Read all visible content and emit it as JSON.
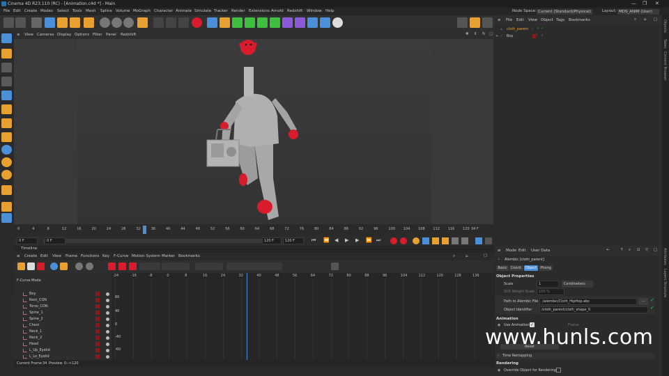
{
  "window": {
    "title": "Cinema 4D R23.110 (RC) - [Animation.c4d *] - Main",
    "controls": [
      "—",
      "❐",
      "✕"
    ]
  },
  "menubar": {
    "items": [
      "File",
      "Edit",
      "Create",
      "Modes",
      "Select",
      "Tools",
      "Mesh",
      "Spline",
      "Volume",
      "MoGraph",
      "Character",
      "Animate",
      "Simulate",
      "Tracker",
      "Render",
      "Extensions",
      "Arnold",
      "Redshift",
      "Window",
      "Help"
    ],
    "node_space_label": "Node Space:",
    "node_space_value": "Current (Standard/Physical)",
    "layout_label": "Layout:",
    "layout_value": "MDS_ANIM (User)"
  },
  "viewport": {
    "menu": [
      "View",
      "Cameras",
      "Display",
      "Options",
      "Filter",
      "Panel",
      "Redshift"
    ]
  },
  "ruler": {
    "ticks": [
      "0",
      "4",
      "8",
      "12",
      "16",
      "20",
      "24",
      "28",
      "32",
      "36",
      "40",
      "44",
      "48",
      "52",
      "56",
      "60",
      "64",
      "68",
      "72",
      "76",
      "80",
      "84",
      "88",
      "92",
      "96",
      "100",
      "104",
      "108",
      "112",
      "116",
      "120"
    ],
    "current_frame_label": "34 F",
    "current_frame": 34,
    "max_frame": 120
  },
  "playback": {
    "start_field": "0 F",
    "min_field": "0 F",
    "max_field": "120 F",
    "end_field": "120 F"
  },
  "timeline": {
    "title": "Timeline",
    "menu": [
      "Create",
      "Edit",
      "View",
      "Frame",
      "Functions",
      "Key",
      "F-Curve",
      "Motion System",
      "Marker",
      "Bookmarks"
    ],
    "mode_label": "F-Curve Mode",
    "tracks": [
      "Boy",
      "Root_CON",
      "Torso_CON",
      "Spine_1",
      "Spine_2",
      "Chest",
      "Neck_1",
      "Neck_2",
      "Head",
      "L_Up_Eyelid",
      "L_Lo_Eyelid"
    ],
    "graph_ticks": [
      "-24",
      "-16",
      "-8",
      "0",
      "8",
      "16",
      "24",
      "32",
      "40",
      "48",
      "56",
      "64",
      "72",
      "80",
      "88",
      "96",
      "104",
      "112",
      "120",
      "128",
      "136"
    ],
    "y_labels": [
      "60",
      "40",
      "0",
      "-40",
      "-60"
    ],
    "status_current_frame_label": "Current Frame",
    "status_current_frame": "34",
    "status_preview_label": "Preview",
    "status_preview": "0-->120"
  },
  "object_manager": {
    "menu": [
      "File",
      "Edit",
      "View",
      "Object",
      "Tags",
      "Bookmarks"
    ],
    "objects": [
      {
        "name": "cloth_parent",
        "selected": true
      },
      {
        "name": "Boy",
        "selected": false
      }
    ]
  },
  "attributes": {
    "menu": [
      "Mode",
      "Edit",
      "User Data"
    ],
    "object_title": "Alembic [cloth_parent]",
    "tabs": [
      "Basic",
      "Coord.",
      "Object",
      "Phong"
    ],
    "active_tab": "Object",
    "section_object": "Object Properties",
    "scale_label": "Scale",
    "scale_value": "1",
    "scale_unit": "Centimeters",
    "sds_label": "SDS Weight Scale",
    "sds_value": "100 %",
    "path_label": "Path to Alembic File",
    "path_value": "./alembic/Cloth_HipHop.abc",
    "path_button": "...",
    "identifier_label": "Object Identifier",
    "identifier_value": "/cloth_parent/cloth_shape_0",
    "section_animation": "Animation",
    "use_animation_label": "Use Animation",
    "frame_label": "Frame",
    "reset_label": "Reset",
    "time_remapping": "Time Remapping",
    "section_rendering": "Rendering",
    "override_label": "Override Object for Rendering"
  },
  "right_strip": {
    "tabs": [
      "Objects",
      "Takes",
      "Content Browser",
      "Attributes",
      "Layers",
      "Structure"
    ]
  },
  "watermark": "www.hunls.com",
  "colors": {
    "accent_blue": "#4a8fd8",
    "character_red": "#d81c2c",
    "cloth_gray": "#a8a8a8",
    "selected_orange": "#e8a030",
    "check_green": "#3fbf3f"
  }
}
